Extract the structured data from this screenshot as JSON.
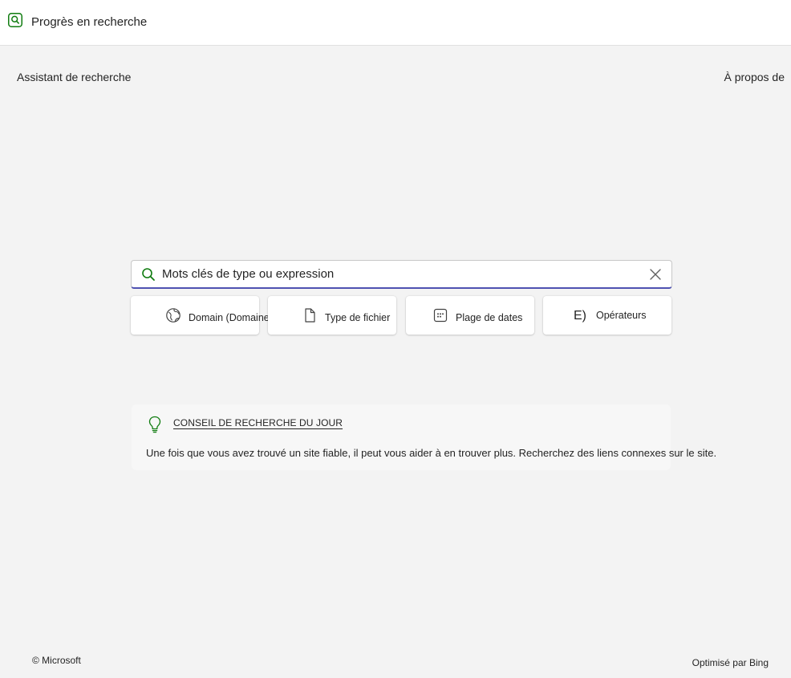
{
  "header": {
    "title": "Progrès en recherche",
    "icon": "search-app-icon",
    "accent_color": "#107c10"
  },
  "nav": {
    "left_label": "Assistant de recherche",
    "right_label": "À propos de"
  },
  "search": {
    "placeholder": "Mots clés de type ou expression",
    "value": "",
    "focus_color": "#4f52b2"
  },
  "filters": [
    {
      "label": "Domain (Domaine)",
      "icon": "globe-icon"
    },
    {
      "label": "Type de fichier",
      "icon": "file-icon"
    },
    {
      "label": "Plage de dates",
      "icon": "calendar-icon"
    },
    {
      "label": "Opérateurs",
      "icon": "operators-icon",
      "icon_text": "E)"
    }
  ],
  "tip": {
    "title": "CONSEIL DE RECHERCHE DU JOUR",
    "body": "Une fois que vous avez trouvé un site fiable, il peut vous aider à en trouver plus. Recherchez des liens connexes sur le site.",
    "icon": "lightbulb-icon"
  },
  "footer": {
    "left": "© Microsoft",
    "right": "Optimisé par Bing"
  }
}
